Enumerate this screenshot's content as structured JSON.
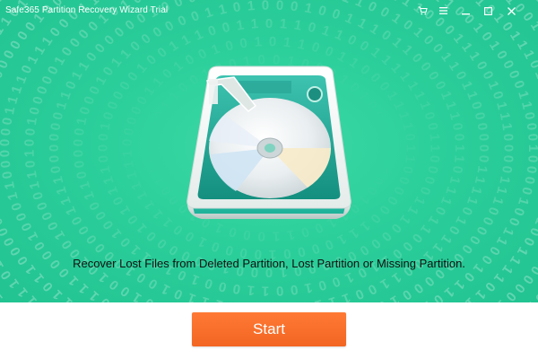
{
  "window": {
    "title": "Safe365 Partition Recovery Wizard Trial"
  },
  "titlebar_icons": [
    "cart-icon",
    "menu-icon",
    "minimize-icon",
    "maximize-icon",
    "close-icon"
  ],
  "hero": {
    "illustration": "hard-drive-icon",
    "background_pattern": "binary-digits",
    "message": "Recover Lost Files from Deleted Partition, Lost Partition or Missing Partition."
  },
  "actions": {
    "start_label": "Start"
  },
  "colors": {
    "hero_green": "#2bcf9a",
    "accent_orange": "#f26522",
    "bottom_bar": "#ffffff"
  }
}
